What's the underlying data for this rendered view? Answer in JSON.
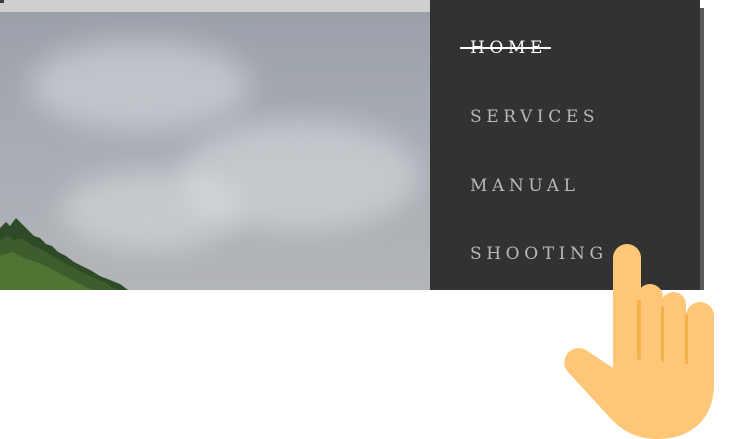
{
  "nav": {
    "items": [
      {
        "label": "HOME",
        "active": true
      },
      {
        "label": "SERVICES",
        "active": false
      },
      {
        "label": "MANUAL",
        "active": false
      },
      {
        "label": "SHOOTING",
        "active": false
      }
    ]
  },
  "colors": {
    "panel_background": "#323232",
    "nav_text": "#b9b9b9",
    "nav_active_text": "#ffffff",
    "hand": "#fdc777"
  },
  "icons": {
    "pointer": "pointing-hand-icon"
  }
}
